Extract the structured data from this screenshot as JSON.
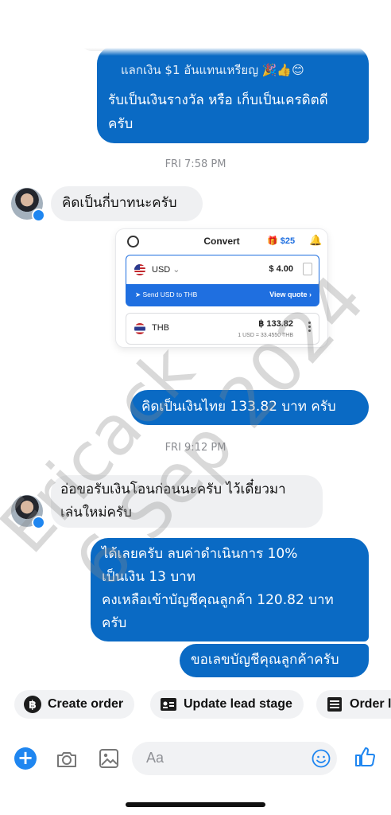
{
  "header": {
    "baht_symbol": "฿"
  },
  "messages": {
    "top_partial_line": "แลกเงิน $1 อันแทนเหรียญ 🎉👍😊",
    "top_line_1": "รับเป็นเงินรางวัล หรือ เก็บเป็นเครดิตดี",
    "top_line_2": "ครับ",
    "time_1": "FRI 7:58 PM",
    "incoming_1": "คิดเป็นกี่บาทนะครับ",
    "outgoing_1": "คิดเป็นเงินไทย 133.82 บาท ครับ",
    "time_2": "FRI 9:12 PM",
    "incoming_2_line_1": "อ่อขอรับเงินโอนก่อนนะครับ ไว้เดี๋ยวมา",
    "incoming_2_line_2": "เล่นใหม่ครับ",
    "outgoing_2_line_1": "ได้เลยครับ ลบค่าดำเนินการ 10%",
    "outgoing_2_line_2": "เป็นเงิน 13 บาท",
    "outgoing_2_line_3": "คงเหลือเข้าบัญชีคุณลูกค้า 120.82 บาท",
    "outgoing_2_line_4": "ครับ",
    "outgoing_3": "ขอเลขบัญชีคุณลูกค้าครับ"
  },
  "convert_card": {
    "title": "Convert",
    "gift_amount": "$25",
    "from_currency": "USD",
    "from_amount": "$ 4.00",
    "send_label": "Send USD to THB",
    "view_quote": "View quote",
    "to_currency": "THB",
    "to_amount": "฿ 133.82",
    "rate": "1 USD = 33.4550 THB"
  },
  "watermark": {
    "line_1": "Ericack",
    "line_2": "6 Sep 2024"
  },
  "quick_replies": [
    {
      "label": "Create order",
      "icon": "baht-circle-icon"
    },
    {
      "label": "Update lead stage",
      "icon": "id-card-icon"
    },
    {
      "label": "Order l",
      "icon": "list-icon"
    }
  ],
  "composer": {
    "placeholder": "Aa"
  },
  "colors": {
    "outgoing_bubble": "#0a6ac4",
    "incoming_bubble": "#eff0f2",
    "accent": "#1f86f0"
  }
}
